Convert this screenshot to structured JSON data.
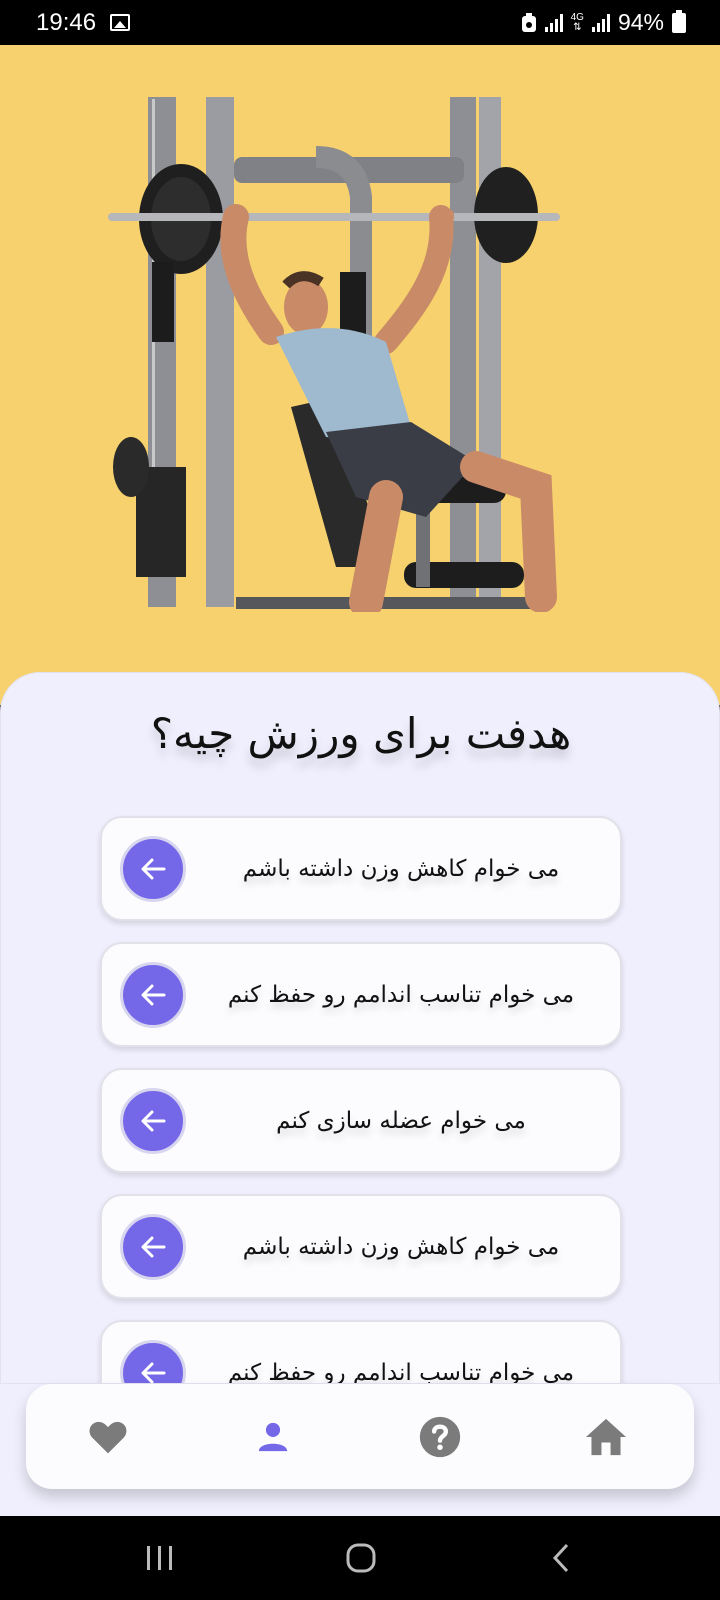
{
  "status_bar": {
    "time": "19:46",
    "network": "4G",
    "battery": "94%"
  },
  "hero": {
    "image": "man-bench-press-smith-machine"
  },
  "question": {
    "title": "هدفت برای ورزش چیه؟",
    "options": [
      {
        "label": "می خوام کاهش وزن داشته باشم"
      },
      {
        "label": "می خوام تناسب اندامم رو حفظ کنم"
      },
      {
        "label": "می خوام عضله سازی کنم"
      },
      {
        "label": "می خوام کاهش وزن داشته باشم"
      },
      {
        "label": "می خوام تناسب اندامم رو حفظ کنم"
      }
    ]
  },
  "bottom_nav": {
    "items": [
      {
        "icon": "heart-icon"
      },
      {
        "icon": "person-icon",
        "active": true
      },
      {
        "icon": "help-icon"
      },
      {
        "icon": "home-icon"
      }
    ],
    "active_color": "#7468E8",
    "inactive_color": "#7B7B7B"
  },
  "colors": {
    "hero_bg": "#F6D16D",
    "sheet_bg": "#F0EFFD",
    "accent": "#7468E8"
  }
}
